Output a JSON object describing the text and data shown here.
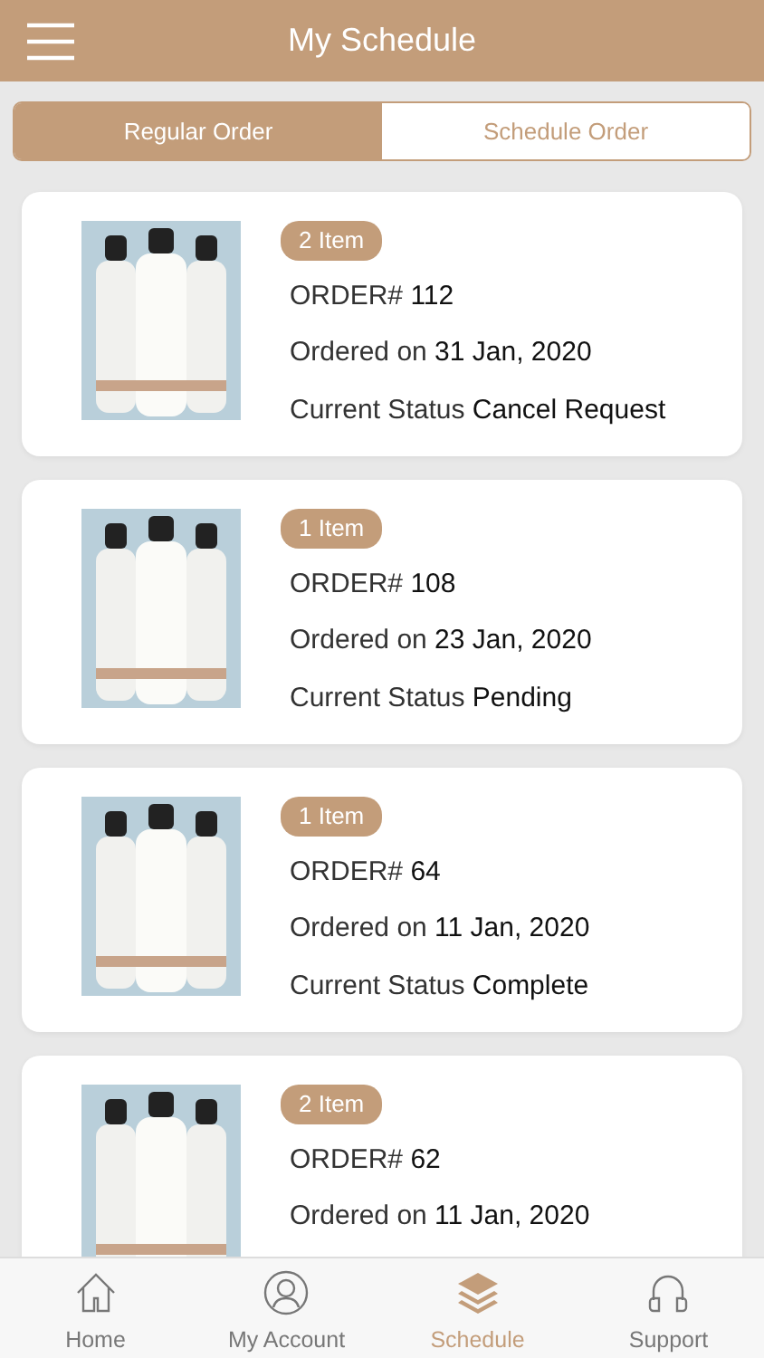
{
  "header": {
    "title": "My Schedule"
  },
  "segments": [
    {
      "label": "Regular Order",
      "selected": true
    },
    {
      "label": "Schedule Order",
      "selected": false
    }
  ],
  "orders": [
    {
      "badge": "2 Item",
      "order": "ORDER# **112**",
      "ordered": "Ordered on **31 Jan, 2020**",
      "status": "Current Status **Cancel Request**"
    },
    {
      "badge": "1 Item",
      "order": "ORDER# **108**",
      "ordered": "Ordered on **23 Jan, 2020**",
      "status": "Current Status **Pending**"
    },
    {
      "badge": "1 Item",
      "order": "ORDER# **64**",
      "ordered": "Ordered on **11 Jan, 2020**",
      "status": "Current Status **Complete**"
    },
    {
      "badge": "2 Item",
      "order": "ORDER# **62**",
      "ordered": "Ordered on **11 Jan, 2020**"
    }
  ],
  "tabbar": [
    {
      "label": "Home",
      "kind": "home",
      "selected": false
    },
    {
      "label": "My Account",
      "kind": "account",
      "selected": false
    },
    {
      "label": "Schedule",
      "kind": "layers",
      "selected": true
    },
    {
      "label": "Support",
      "kind": "headphones",
      "selected": false
    }
  ]
}
